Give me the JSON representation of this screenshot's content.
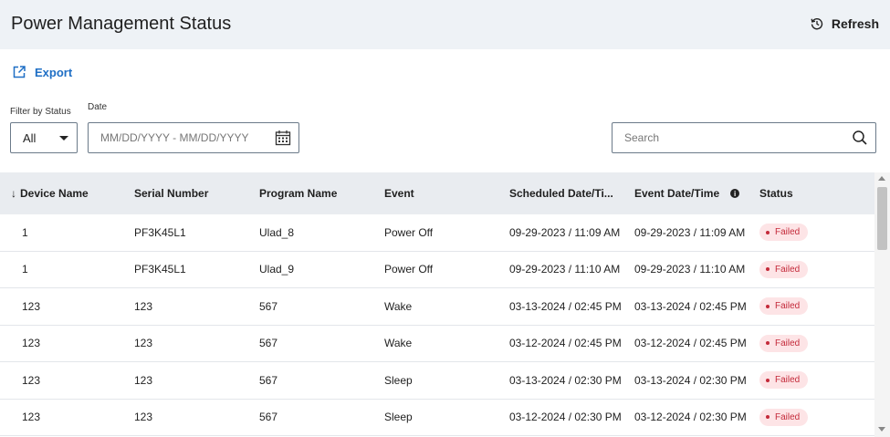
{
  "header": {
    "title": "Power Management Status",
    "refresh_label": "Refresh"
  },
  "toolbar": {
    "export_label": "Export"
  },
  "filters": {
    "status_label": "Filter by Status",
    "status_value": "All",
    "date_label": "Date",
    "date_placeholder": "MM/DD/YYYY - MM/DD/YYYY",
    "search_placeholder": "Search"
  },
  "table": {
    "columns": [
      "Device Name",
      "Serial Number",
      "Program Name",
      "Event",
      "Scheduled Date/Ti...",
      "Event Date/Time",
      "Status"
    ],
    "rows": [
      [
        "1",
        "PF3K45L1",
        "Ulad_8",
        "Power Off",
        "09-29-2023 / 11:09 AM",
        "09-29-2023 / 11:09 AM",
        "Failed"
      ],
      [
        "1",
        "PF3K45L1",
        "Ulad_9",
        "Power Off",
        "09-29-2023 / 11:10 AM",
        "09-29-2023 / 11:10 AM",
        "Failed"
      ],
      [
        "123",
        "123",
        "567",
        "Wake",
        "03-13-2024 / 02:45 PM",
        "03-13-2024 / 02:45 PM",
        "Failed"
      ],
      [
        "123",
        "123",
        "567",
        "Wake",
        "03-12-2024 / 02:45 PM",
        "03-12-2024 / 02:45 PM",
        "Failed"
      ],
      [
        "123",
        "123",
        "567",
        "Sleep",
        "03-13-2024 / 02:30 PM",
        "03-13-2024 / 02:30 PM",
        "Failed"
      ],
      [
        "123",
        "123",
        "567",
        "Sleep",
        "03-12-2024 / 02:30 PM",
        "03-12-2024 / 02:30 PM",
        "Failed"
      ]
    ]
  },
  "icons": {
    "refresh": "refresh-icon",
    "export": "external-link-icon",
    "calendar": "calendar-icon",
    "search": "search-icon",
    "sort": "arrow-down-icon",
    "info": "info-icon"
  },
  "colors": {
    "accent": "#1f6fc5",
    "header_bg": "#eef2f6",
    "table_header_bg": "#e9ecf0",
    "failed_bg": "#fde4e6",
    "failed_text": "#c42a3a"
  }
}
